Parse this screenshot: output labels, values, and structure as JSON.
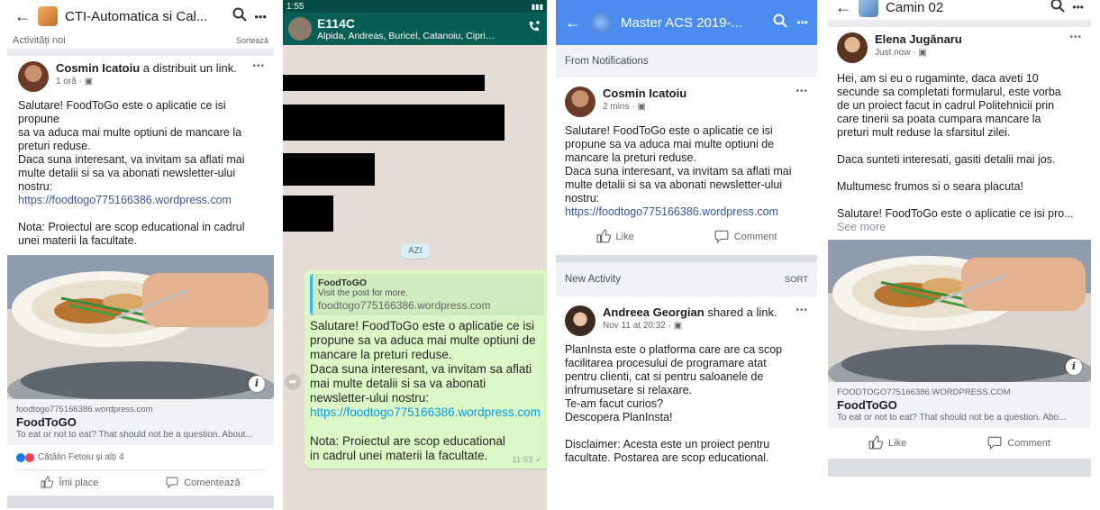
{
  "panel1": {
    "header_title": "CTI-Automatica si Cal...",
    "section_label": "Activități noi",
    "sort_label": "Sortează",
    "author": "Cosmin Icatoiu",
    "action_text": " a distribuit un link.",
    "time": "1 oră · ▣",
    "text": "Salutare! FoodToGo este o aplicatie ce isi propune\nsa va aduca mai multe optiuni de mancare la\npreturi reduse.\nDaca suna interesant, va invitam sa aflati mai\nmulte detalii si sa va abonati newsletter-ului\nnostru:",
    "link": "https://foodtogo775166386.wordpress.com",
    "note": "Nota: Proiectul are scop educational in cadrul\nunei materii la facultate.",
    "card_domain": "foodtogo775166386.wordpress.com",
    "card_title": "FoodToGO",
    "card_desc": "To eat or not to eat? That should not be a question. About...",
    "reactions": "Cătălin Fetoiu și alți 4",
    "like_label": "Îmi place",
    "comment_label": "Comentează"
  },
  "panel2": {
    "status_time": "1:55",
    "chat_title": "E114C",
    "chat_members": "Alpida, Andreas, Buricel, Catanoiu, Ciprian,...",
    "date_badge": "AZI",
    "preview_title": "FoodToGO",
    "preview_desc": "Visit the post for more.",
    "preview_domain": "foodtogo775166386.wordpress.com",
    "msg_text": "Salutare! FoodToGo este o aplicatie ce isi propune sa va aduca mai multe optiuni de mancare la preturi reduse.\nDaca suna interesant, va invitam sa aflati mai multe detalii si sa va abonati newsletter-ului nostru:",
    "msg_link": "https://foodtogo775166386.wordpress.com",
    "msg_note": "Nota: Proiectul are scop educational in cadrul unei materii la facultate.",
    "msg_time": "11:53 ✓"
  },
  "panel3": {
    "header_title": "Master ACS 2019-...",
    "section1": "From Notifications",
    "author": "Cosmin Icatoiu",
    "time": "2 mins · ▣",
    "text": "Salutare! FoodToGo este o aplicatie ce isi\npropune sa va aduca mai multe optiuni de\nmancare la preturi reduse.\nDaca suna interesant, va invitam sa aflati mai\nmulte detalii si sa va abonati newsletter-ului\nnostru:",
    "link": "https://foodtogo775166386.wordpress.com",
    "like_label": "Like",
    "comment_label": "Comment",
    "section2": "New Activity",
    "sort_label": "SORT",
    "author2": "Andreea Georgian",
    "action2": " shared a link.",
    "time2": "Nov 11 at 20:32 · ▣",
    "text2": "PlanInsta este o platforma care are ca scop\nfacilitarea procesului de programare atat\npentru clienti, cat si pentru saloanele de\ninfrumusetare si relaxare.\nTe-am facut curios?\nDescopera PlanInsta!\n\nDisclaimer: Acesta este un proiect pentru\nfacultate. Postarea are scop educational."
  },
  "panel4": {
    "header_title": "Camin 02",
    "author": "Elena Jugănaru",
    "time": "Just now · ▣",
    "text": "Hei, am si eu o rugaminte, daca aveti 10\nsecunde sa completati formularul, este vorba\nde un proiect facut in cadrul Politehnicii prin\ncare tinerii sa poata cumpara mancare la\npreturi mult reduse la sfarsitul zilei.\n\nDaca sunteti interesati, gasiti detalii mai jos.\n\nMultumesc frumos si o seara placuta!\n\nSalutare! FoodToGo este o aplicatie ce isi pro...",
    "see_more": "See more",
    "card_domain": "FOODTOGO775166386.WORDPRESS.COM",
    "card_title": "FoodToGO",
    "card_desc": "To eat or not to eat? That should not be a question. Abo...",
    "like_label": "Like",
    "comment_label": "Comment"
  },
  "icons": {
    "back": "←",
    "search": "⚲",
    "more": "•••",
    "info": "i"
  }
}
